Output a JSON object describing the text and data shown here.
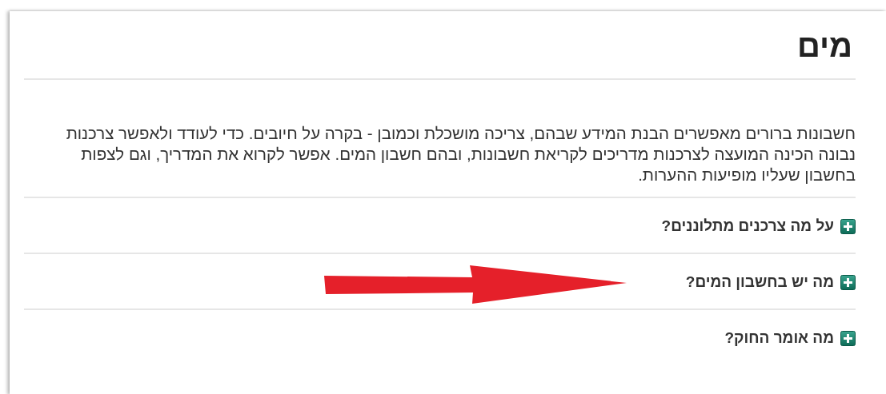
{
  "title": "מים",
  "intro": "חשבונות ברורים מאפשרים הבנת המידע שבהם, צריכה מושכלת וכמובן - בקרה על חיובים. כדי לעודד ולאפשר צרכנות נבונה הכינה המועצה לצרכנות מדריכים לקריאת חשבונות, ובהם חשבון המים. אפשר לקרוא את המדריך, וגם לצפות בחשבון שעליו מופיעות ההערות.",
  "sections": [
    {
      "label": "על מה צרכנים מתלוננים?",
      "expanded": false
    },
    {
      "label": "מה יש בחשבון המים?",
      "expanded": false,
      "annotation": {
        "kind": "arrow"
      }
    },
    {
      "label": "מה אומר החוק?",
      "expanded": false
    }
  ]
}
